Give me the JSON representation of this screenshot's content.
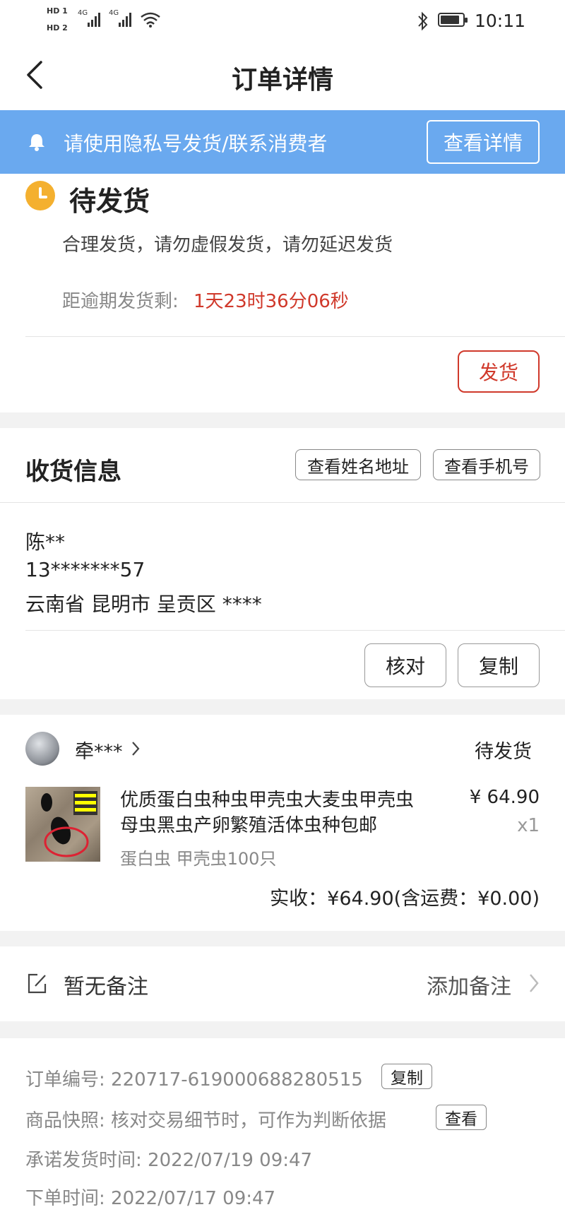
{
  "status_bar": {
    "sim1": "HD 1",
    "sim2": "HD 2",
    "net1": "4G",
    "net2": "4G",
    "time": "10:11"
  },
  "nav": {
    "title": "订单详情"
  },
  "notice": {
    "text": "请使用隐私号发货/联系消费者",
    "button": "查看详情"
  },
  "order_status": {
    "title": "待发货",
    "tip": "合理发货，请勿虚假发货，请勿延迟发货",
    "countdown_label": "距逾期发货剩:",
    "countdown_value": "1天23时36分06秒",
    "ship_button": "发货",
    "accent_color": "#d0392b"
  },
  "shipping": {
    "heading": "收货信息",
    "view_name_address": "查看姓名地址",
    "view_phone": "查看手机号",
    "name": "陈**",
    "phone": "13*******57",
    "address": "云南省 昆明市 呈贡区 ****",
    "verify_button": "核对",
    "copy_button": "复制"
  },
  "product": {
    "buyer": "牵***",
    "status": "待发货",
    "title_line1": "优质蛋白虫种虫甲壳虫大麦虫甲壳虫",
    "title_line2": "母虫黑虫产卵繁殖活体虫种包邮",
    "sku": "蛋白虫 甲壳虫100只",
    "price": "¥ 64.90",
    "quantity": "x1",
    "paid_label": "实收：",
    "paid_value": "¥64.90(含运费：¥0.00)"
  },
  "remark": {
    "text": "暂无备注",
    "add": "添加备注"
  },
  "order_info": {
    "order_no_label": "订单编号: ",
    "order_no": "220717-619000688280515",
    "order_no_copy": "复制",
    "snapshot_label": "商品快照: ",
    "snapshot_text": "核对交易细节时，可作为判断依据",
    "snapshot_view": "查看",
    "promise_label": "承诺发货时间: ",
    "promise_time": "2022/07/19 09:47",
    "order_time_label": "下单时间: ",
    "order_time": "2022/07/17 09:47"
  }
}
